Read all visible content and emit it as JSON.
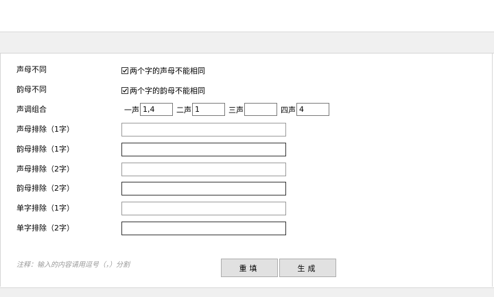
{
  "form": {
    "row1_label": "声母不同",
    "row1_check_text": "两个字的声母不能相同",
    "row1_checked": true,
    "row2_label": "韵母不同",
    "row2_check_text": "两个字的韵母不能相同",
    "row2_checked": true,
    "tone_label": "声调组合",
    "tones": [
      {
        "label": "一声",
        "value": "1,4"
      },
      {
        "label": "二声",
        "value": "1"
      },
      {
        "label": "三声",
        "value": ""
      },
      {
        "label": "四声",
        "value": "4"
      }
    ],
    "excl_initial_1_label": "声母排除（1字）",
    "excl_initial_1_value": "",
    "excl_final_1_label": "韵母排除（1字）",
    "excl_final_1_value": "",
    "excl_initial_2_label": "声母排除（2字）",
    "excl_initial_2_value": "",
    "excl_final_2_label": "韵母排除（2字）",
    "excl_final_2_value": "",
    "excl_char_1_label": "单字排除（1字）",
    "excl_char_1_value": "",
    "excl_char_2_label": "单字排除（2字）",
    "excl_char_2_value": ""
  },
  "footer": {
    "note": "注释：输入的内容请用逗号（，）分割",
    "reset_label": "重填",
    "generate_label": "生成"
  },
  "icons": {
    "checkbox_mark": "check-icon"
  },
  "colors": {
    "panel_bg": "#ffffff",
    "bar_bg": "#f0f0f0",
    "button_bg": "#e1e1e1",
    "note_color": "#9a9a9a"
  }
}
